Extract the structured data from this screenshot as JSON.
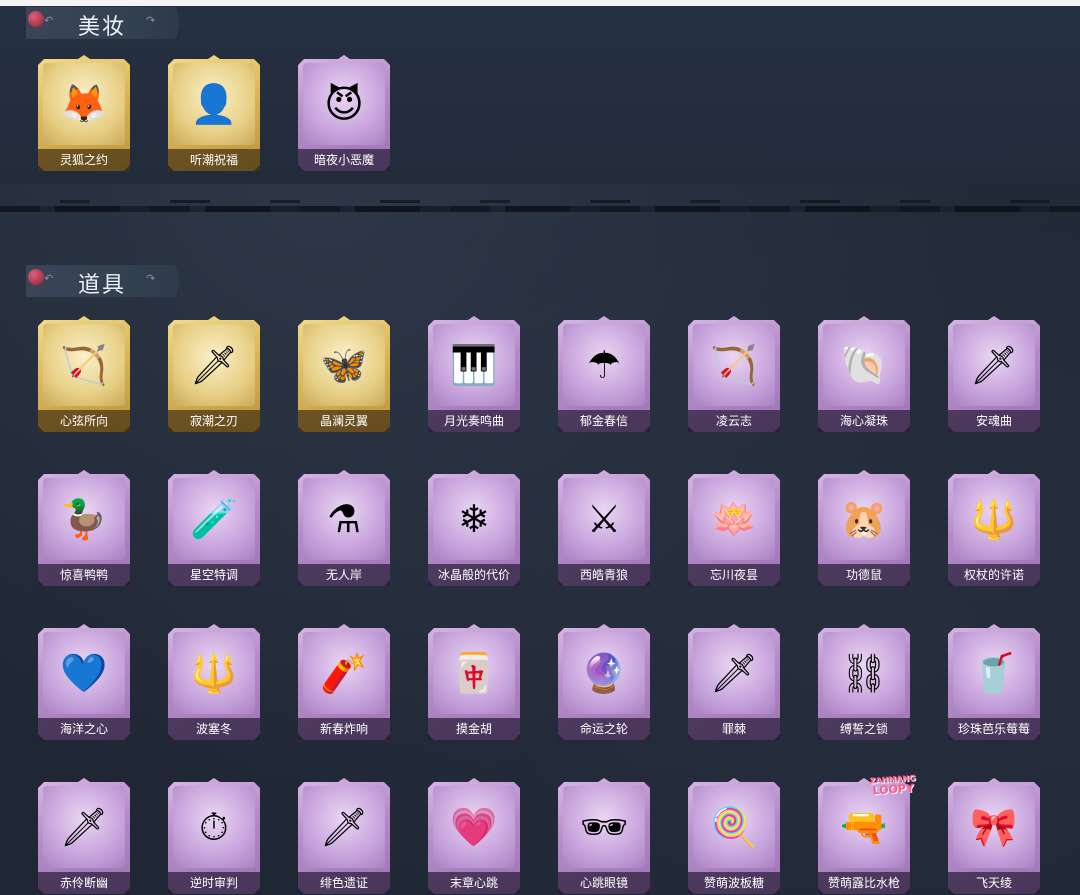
{
  "sections": [
    {
      "title": "美妆",
      "items": [
        {
          "label": "灵狐之约",
          "rarity": "gold",
          "icon": "fox-ear-avatar-icon",
          "glyph": "🦊"
        },
        {
          "label": "听潮祝福",
          "rarity": "gold",
          "icon": "wing-avatar-icon",
          "glyph": "👤"
        },
        {
          "label": "暗夜小恶魔",
          "rarity": "purple",
          "icon": "devil-horn-avatar-icon",
          "glyph": "😈"
        }
      ]
    },
    {
      "title": "道具",
      "items": [
        {
          "label": "心弦所向",
          "rarity": "gold",
          "icon": "bow-icon",
          "glyph": "🏹"
        },
        {
          "label": "寂潮之刃",
          "rarity": "gold",
          "icon": "blade-icon",
          "glyph": "🗡"
        },
        {
          "label": "晶澜灵翼",
          "rarity": "gold",
          "icon": "crystal-wings-icon",
          "glyph": "🦋"
        },
        {
          "label": "月光奏鸣曲",
          "rarity": "purple",
          "icon": "piano-icon",
          "glyph": "🎹"
        },
        {
          "label": "郁金春信",
          "rarity": "purple",
          "icon": "parasol-icon",
          "glyph": "☂"
        },
        {
          "label": "凌云志",
          "rarity": "purple",
          "icon": "bow-icon",
          "glyph": "🏹"
        },
        {
          "label": "海心凝珠",
          "rarity": "purple",
          "icon": "shell-pearl-icon",
          "glyph": "🐚"
        },
        {
          "label": "安魂曲",
          "rarity": "purple",
          "icon": "blade-icon",
          "glyph": "🗡"
        },
        {
          "label": "惊喜鸭鸭",
          "rarity": "purple",
          "icon": "duck-box-icon",
          "glyph": "🦆"
        },
        {
          "label": "星空特调",
          "rarity": "purple",
          "icon": "bottle-icon",
          "glyph": "🧪"
        },
        {
          "label": "无人岸",
          "rarity": "purple",
          "icon": "perfume-bottle-icon",
          "glyph": "⚗"
        },
        {
          "label": "冰晶般的代价",
          "rarity": "purple",
          "icon": "ice-lotus-icon",
          "glyph": "❄"
        },
        {
          "label": "西皓青狼",
          "rarity": "purple",
          "icon": "chain-staff-icon",
          "glyph": "⚔"
        },
        {
          "label": "忘川夜昙",
          "rarity": "purple",
          "icon": "lotus-icon",
          "glyph": "🪷"
        },
        {
          "label": "功德鼠",
          "rarity": "purple",
          "icon": "hamster-icon",
          "glyph": "🐹"
        },
        {
          "label": "权杖的许诺",
          "rarity": "purple",
          "icon": "scepter-icon",
          "glyph": "🔱"
        },
        {
          "label": "海洋之心",
          "rarity": "purple",
          "icon": "heart-necklace-icon",
          "glyph": "💙"
        },
        {
          "label": "波塞冬",
          "rarity": "purple",
          "icon": "trident-icon",
          "glyph": "🔱"
        },
        {
          "label": "新春炸响",
          "rarity": "purple",
          "icon": "firecracker-icon",
          "glyph": "🧨"
        },
        {
          "label": "摸金胡",
          "rarity": "purple",
          "icon": "mahjong-tile-icon",
          "glyph": "🀄"
        },
        {
          "label": "命运之轮",
          "rarity": "purple",
          "icon": "wheel-icon",
          "glyph": "🔮"
        },
        {
          "label": "罪棘",
          "rarity": "purple",
          "icon": "spear-icon",
          "glyph": "🗡"
        },
        {
          "label": "缚誓之锁",
          "rarity": "purple",
          "icon": "chain-icon",
          "glyph": "⛓"
        },
        {
          "label": "珍珠芭乐莓莓",
          "rarity": "purple",
          "icon": "drink-cup-icon",
          "glyph": "🥤"
        },
        {
          "label": "赤伶断幽",
          "rarity": "purple",
          "icon": "red-blade-icon",
          "glyph": "🗡"
        },
        {
          "label": "逆时审判",
          "rarity": "purple",
          "icon": "pocket-watch-icon",
          "glyph": "⏱"
        },
        {
          "label": "绯色遗证",
          "rarity": "purple",
          "icon": "rapier-icon",
          "glyph": "🗡"
        },
        {
          "label": "末章心跳",
          "rarity": "purple",
          "icon": "heart-wand-icon",
          "glyph": "💗"
        },
        {
          "label": "心跳眼镜",
          "rarity": "purple",
          "icon": "heart-glasses-icon",
          "glyph": "🕶"
        },
        {
          "label": "赞萌波板糖",
          "rarity": "purple",
          "icon": "lollipop-icon",
          "glyph": "🍭"
        },
        {
          "label": "赞萌露比水枪",
          "rarity": "purple",
          "icon": "water-gun-icon",
          "glyph": "🔫"
        },
        {
          "label": "飞天绫",
          "rarity": "purple",
          "icon": "ribbon-icon",
          "glyph": "🎀"
        }
      ]
    }
  ],
  "watermark": {
    "line1": "ZANMANG",
    "line2": "LOOPY"
  },
  "header_arrow_left": "↶",
  "header_arrow_right": "↷"
}
